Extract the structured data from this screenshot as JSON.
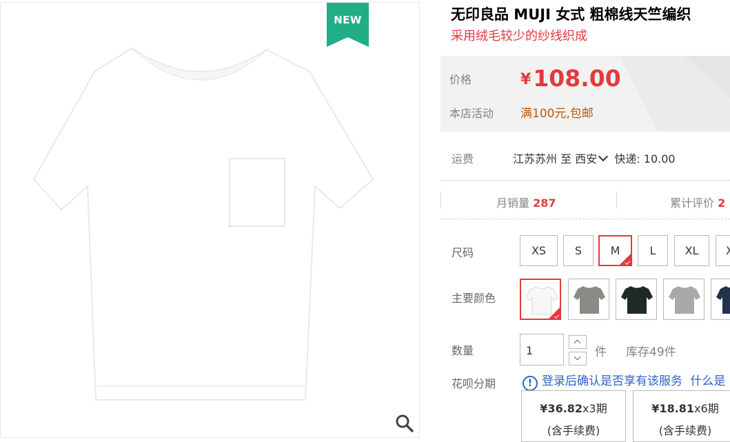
{
  "product": {
    "title": "无印良品 MUJI 女式 粗棉线天竺编织",
    "subtitle": "采用绒毛较少的纱线织成",
    "badge": "NEW"
  },
  "price": {
    "label": "价格",
    "symbol": "¥",
    "value": "108.00",
    "promo_label": "本店活动",
    "promo_text": "满100元,包邮"
  },
  "shipping": {
    "label": "运费",
    "origin": "江苏苏州",
    "to": "至",
    "destination": "西安",
    "method": "快递: 10.00"
  },
  "stats": {
    "monthly_sales_label": "月销量",
    "monthly_sales_value": "287",
    "reviews_label": "累计评价",
    "reviews_value": "2"
  },
  "size": {
    "label": "尺码",
    "options": [
      "XS",
      "S",
      "M",
      "L",
      "XL",
      "X"
    ],
    "selected": "M"
  },
  "color": {
    "label": "主要颜色",
    "options": [
      {
        "name": "white",
        "hex": "#f7f7f7"
      },
      {
        "name": "gray",
        "hex": "#8c8a84"
      },
      {
        "name": "black-green",
        "hex": "#1f2a26"
      },
      {
        "name": "light-gray",
        "hex": "#a9a9a9"
      },
      {
        "name": "navy",
        "hex": "#22334f"
      }
    ]
  },
  "quantity": {
    "label": "数量",
    "value": "1",
    "unit": "件",
    "stock": "库存49件"
  },
  "huabei": {
    "label": "花呗分期",
    "note": "登录后确认是否享有该服务",
    "link": "什么是",
    "plans": [
      {
        "amount": "¥36.82",
        "periods": "x3期",
        "fee": "(含手续费)"
      },
      {
        "amount": "¥18.81",
        "periods": "x6期",
        "fee": "(含手续费)"
      }
    ]
  },
  "colors": {
    "accent": "#e4393c",
    "badge": "#1fae86",
    "promo": "#b7580e",
    "link": "#3060c8"
  }
}
